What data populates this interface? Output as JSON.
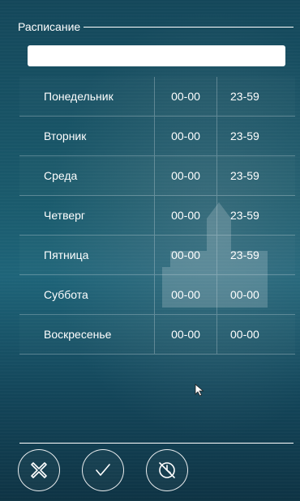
{
  "header": {
    "title": "Расписание"
  },
  "name_input": {
    "value": "",
    "placeholder": ""
  },
  "schedule": {
    "rows": [
      {
        "day": "Понедельник",
        "start": "00-00",
        "end": "23-59"
      },
      {
        "day": "Вторник",
        "start": "00-00",
        "end": "23-59"
      },
      {
        "day": "Среда",
        "start": "00-00",
        "end": "23-59"
      },
      {
        "day": "Четверг",
        "start": "00-00",
        "end": "23-59"
      },
      {
        "day": "Пятница",
        "start": "00-00",
        "end": "23-59"
      },
      {
        "day": "Суббота",
        "start": "00-00",
        "end": "00-00"
      },
      {
        "day": "Воскресенье",
        "start": "00-00",
        "end": "00-00"
      }
    ]
  },
  "actions": {
    "cancel_icon": "cross-icon",
    "confirm_icon": "checkmark-icon",
    "clear_icon": "clear-schedule-icon"
  },
  "colors": {
    "background": "#1a5a6c",
    "text": "#ffffff",
    "input_bg": "#ffffff"
  }
}
